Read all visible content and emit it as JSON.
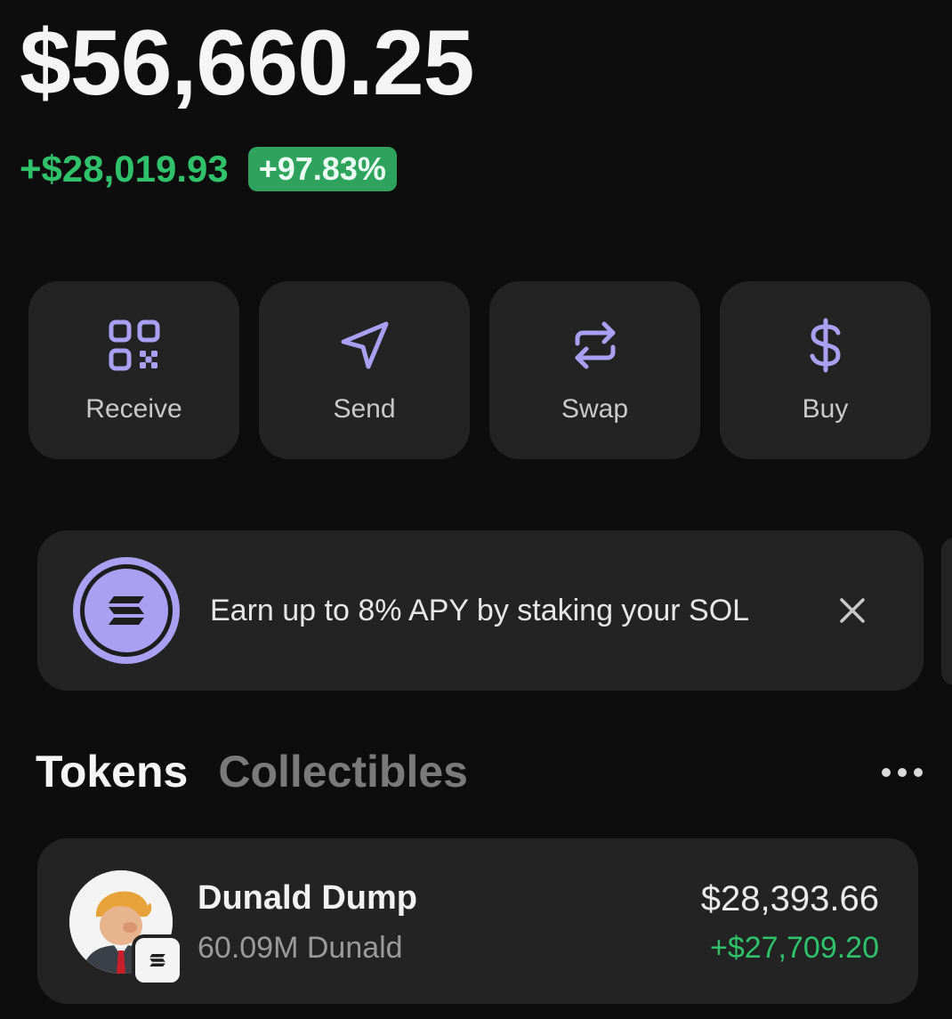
{
  "balance": {
    "total": "$56,660.25",
    "change_amount": "+$28,019.93",
    "change_percent": "+97.83%"
  },
  "actions": [
    {
      "label": "Receive",
      "icon": "qr-code-icon"
    },
    {
      "label": "Send",
      "icon": "send-icon"
    },
    {
      "label": "Swap",
      "icon": "swap-icon"
    },
    {
      "label": "Buy",
      "icon": "dollar-icon"
    }
  ],
  "banner": {
    "text": "Earn up to 8% APY by staking your SOL",
    "icon": "solana-icon"
  },
  "tabs": [
    {
      "label": "Tokens",
      "active": true
    },
    {
      "label": "Collectibles",
      "active": false
    }
  ],
  "tokens": [
    {
      "name": "Dunald Dump",
      "amount": "60.09M Dunald",
      "value": "$28,393.66",
      "change": "+$27,709.20"
    }
  ],
  "colors": {
    "background": "#0d0d0d",
    "card": "#232323",
    "positive": "#2fc26a",
    "accent": "#ab9ff2"
  }
}
